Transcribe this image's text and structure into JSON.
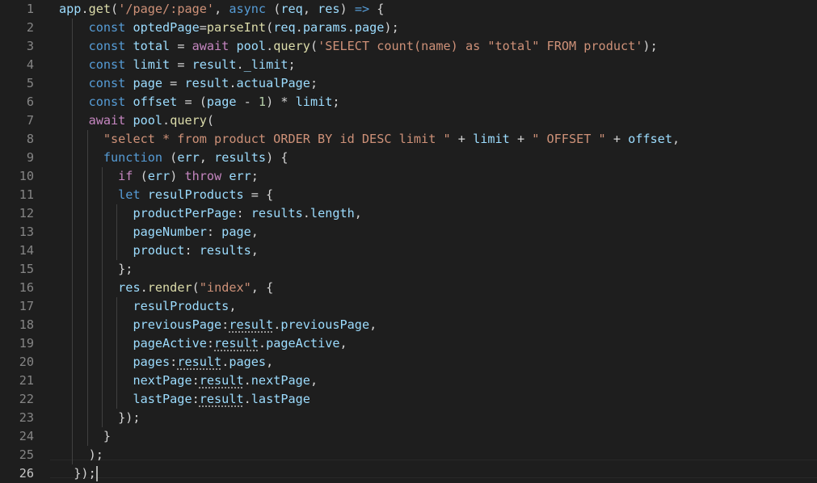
{
  "editor": {
    "language": "javascript",
    "theme_background": "#1e1e1e",
    "active_line": 26,
    "line_numbers": [
      "1",
      "2",
      "3",
      "4",
      "5",
      "6",
      "7",
      "8",
      "9",
      "10",
      "11",
      "12",
      "13",
      "14",
      "15",
      "16",
      "17",
      "18",
      "19",
      "20",
      "21",
      "22",
      "23",
      "24",
      "25",
      "26"
    ],
    "lines": [
      "app.get('/page/:page', async (req, res) => {",
      "    const optedPage=parseInt(req.params.page);",
      "    const total = await pool.query('SELECT count(name) as \"total\" FROM product');",
      "    const limit = result._limit;",
      "    const page = result.actualPage;",
      "    const offset = (page - 1) * limit;",
      "    await pool.query(",
      "      \"select * from product ORDER BY id DESC limit \" + limit + \" OFFSET \" + offset,",
      "      function (err, results) {",
      "        if (err) throw err;",
      "        let resulProducts = {",
      "          productPerPage: results.length,",
      "          pageNumber: page,",
      "          product: results,",
      "        };",
      "        res.render(\"index\", {",
      "          resulProducts,",
      "          previousPage:result.previousPage,",
      "          pageActive:result.pageActive,",
      "          pages:result.pages,",
      "          nextPage:result.nextPage,",
      "          lastPage:result.lastPage",
      "        });",
      "      }",
      "    );",
      "  });"
    ]
  }
}
